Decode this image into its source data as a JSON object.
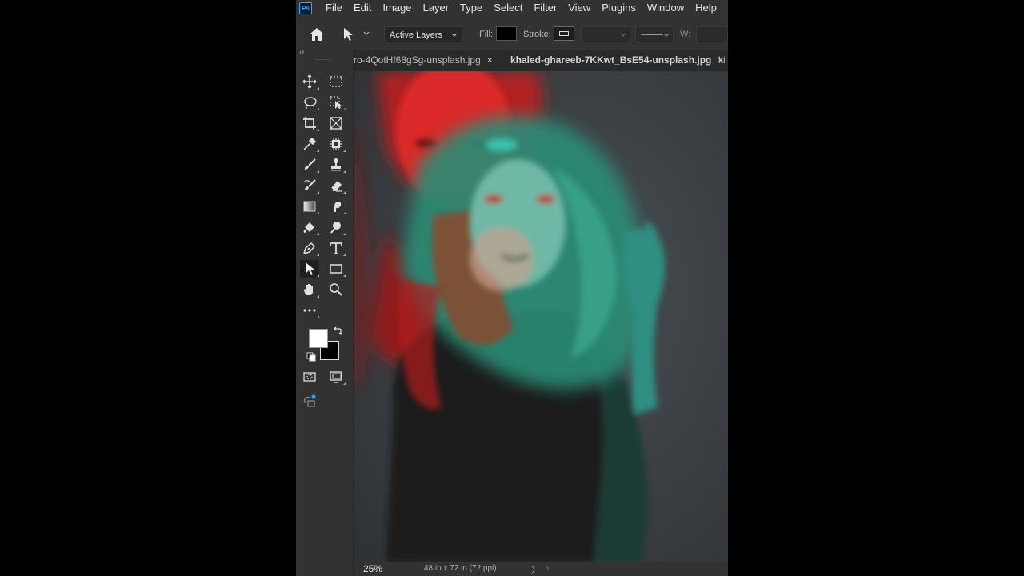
{
  "app": {
    "logo_text": "Ps"
  },
  "menu": [
    "File",
    "Edit",
    "Image",
    "Layer",
    "Type",
    "Select",
    "Filter",
    "View",
    "Plugins",
    "Window",
    "Help"
  ],
  "options_bar": {
    "select_value": "Active Layers",
    "fill_label": "Fill:",
    "stroke_label": "Stroke:",
    "w_label": "W:",
    "fill_color": "#000000"
  },
  "tabs": [
    {
      "label": "ro-4QotHf68gSg-unsplash.jpg",
      "close": "×"
    },
    {
      "label": "khaled-ghareeb-7KKwt_BsE54-unsplash.jpg",
      "close": "×"
    },
    {
      "label": "ki",
      "close": ""
    }
  ],
  "toolbar": {
    "collapse": "‹‹",
    "tools": [
      "move-tool",
      "rectangular-marquee-tool",
      "lasso-tool",
      "object-selection-tool",
      "crop-tool",
      "frame-tool",
      "eyedropper-tool",
      "spot-healing-tool",
      "brush-tool",
      "clone-stamp-tool",
      "history-brush-tool",
      "eraser-tool",
      "gradient-tool",
      "blur-tool",
      "dodge-tool",
      "smudge-tool",
      "pen-tool",
      "type-tool",
      "path-selection-tool",
      "rectangle-tool",
      "hand-tool",
      "zoom-tool",
      "edit-toolbar",
      "quick-mask",
      "screen-mode",
      "content-credentials"
    ],
    "foreground_color": "#ffffff",
    "background_color": "#000000"
  },
  "status": {
    "zoom": "25%",
    "doc_size": "48 in x 72 in (72 ppi)",
    "next_arrow": "〉",
    "scroll_left": "‹"
  },
  "colors": {
    "accent": "#31a8ff",
    "red_channel": "#ff2a2a",
    "cyan_channel": "#2fd6b8",
    "panel": "#323232"
  }
}
